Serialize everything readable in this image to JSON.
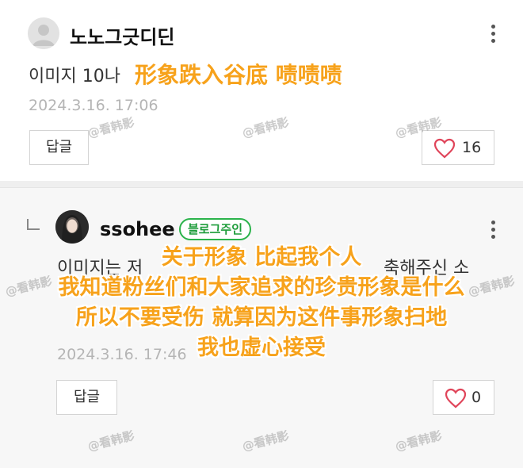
{
  "comments": [
    {
      "author": "노노그긋디딘",
      "text": "이미지 10나",
      "date": "2024.3.16.  17:06",
      "reply_label": "답글",
      "like_count": "16"
    },
    {
      "author": "ssohee",
      "badge": "블로그주인",
      "text": "이미지는 저",
      "text_tail": "축해주신 소",
      "date": "2024.3.16.  17:46",
      "reply_label": "답글",
      "like_count": "0"
    }
  ],
  "overlays": {
    "inline_caption": "形象跌入谷底 啧啧啧",
    "subtitle_lines": [
      "关于形象 比起我个人",
      "我知道粉丝们和大家追求的珍贵形象是什么",
      "所以不要受伤 就算因为这件事形象扫地",
      "我也虚心接受"
    ]
  },
  "watermark": "@看韩影",
  "colors": {
    "caption": "#f7a21b",
    "badge": "#2bb34b",
    "heart": "#e0455a"
  },
  "icons": [
    "more-vertical-icon",
    "heart-icon",
    "reply-arrow-icon",
    "default-avatar-icon"
  ]
}
